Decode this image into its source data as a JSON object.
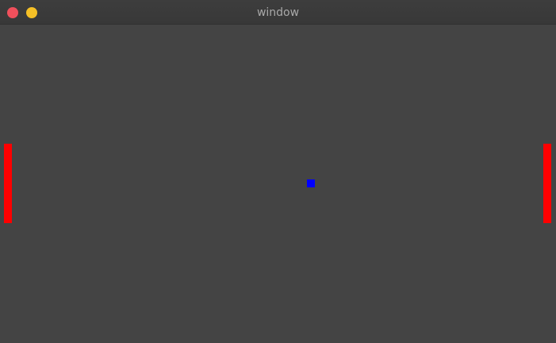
{
  "window": {
    "title": "window"
  },
  "titlebar_buttons": {
    "close_icon": "close-icon",
    "minimize_icon": "minimize-icon",
    "close_color": "#f0505c",
    "minimize_color": "#f5c026"
  },
  "game": {
    "background_color": "#444444",
    "paddle_color": "#ff0000",
    "ball_color": "#0000ff"
  }
}
